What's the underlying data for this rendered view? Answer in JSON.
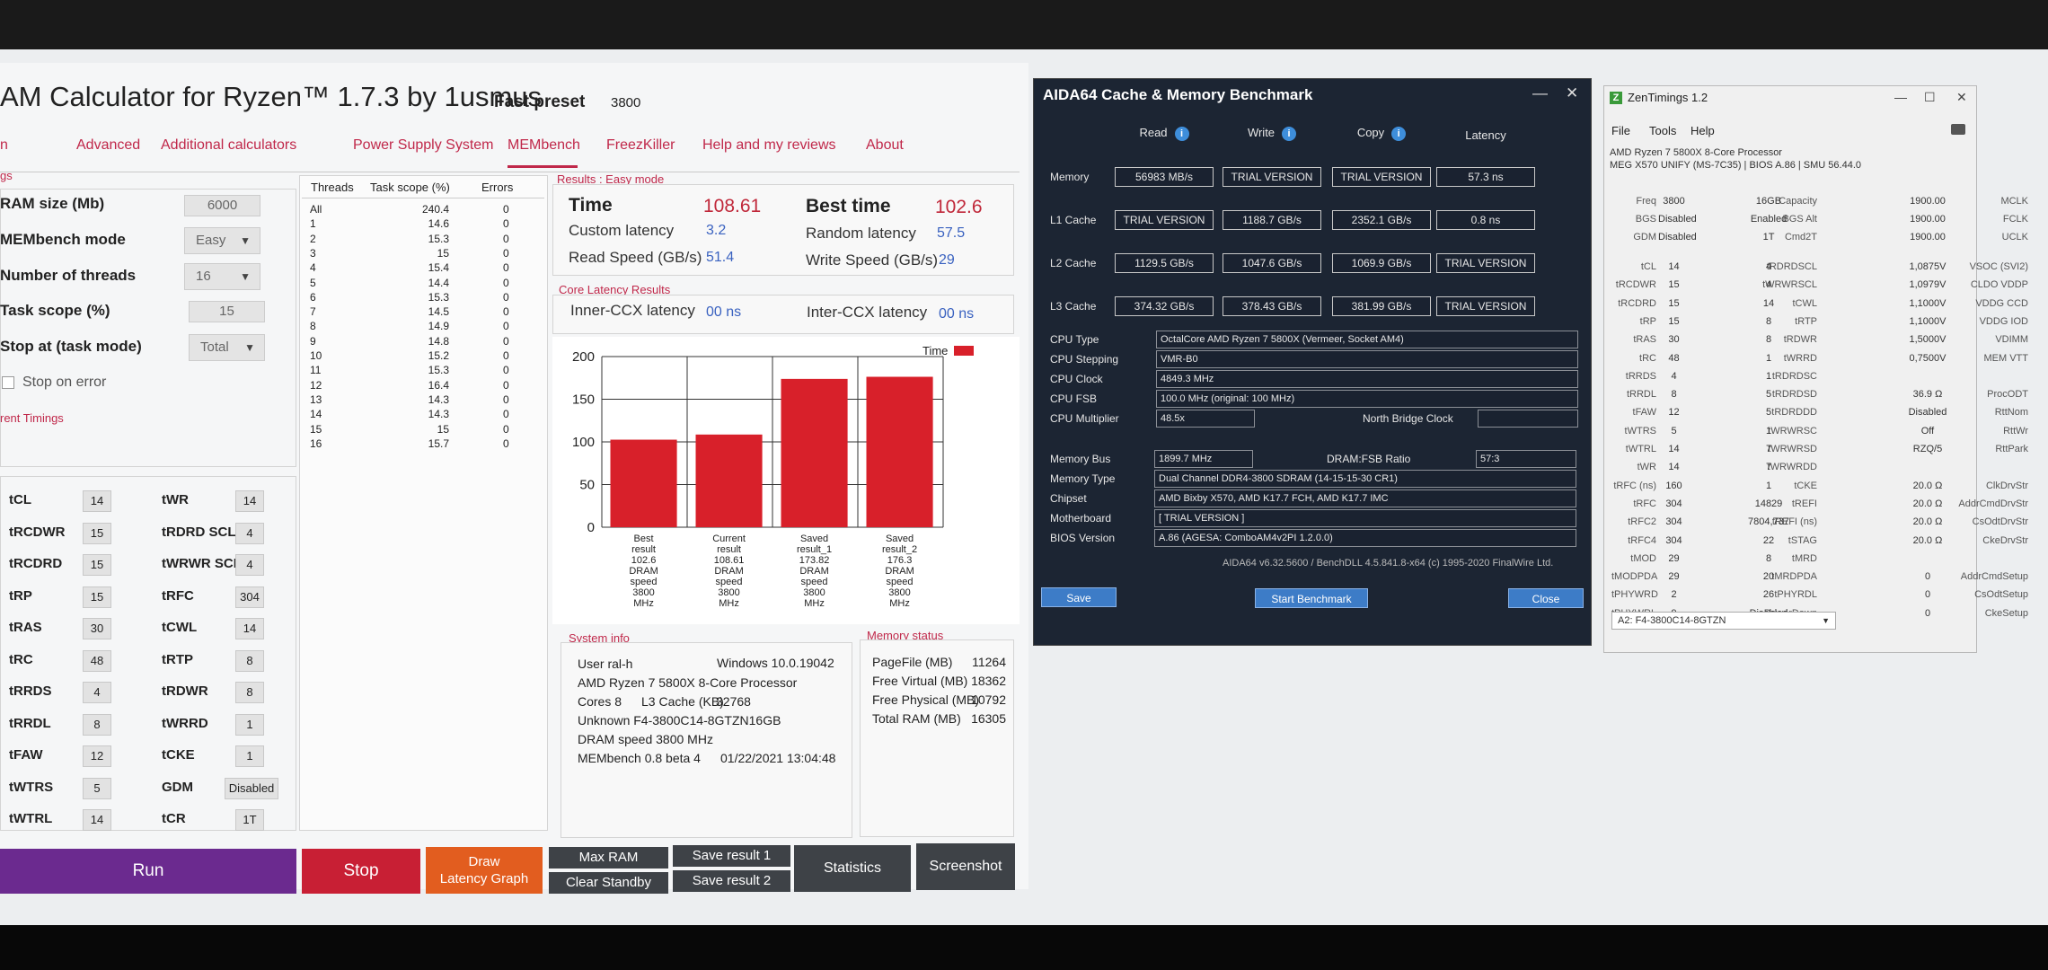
{
  "dram": {
    "title": "AM Calculator for Ryzen™ 1.7.3 by 1usmus",
    "preset_label": "Fast preset",
    "preset_value": "3800",
    "nav": [
      "n",
      "Advanced",
      "Additional calculators",
      "Power Supply System",
      "MEMbench",
      "FreezKiller",
      "Help and my reviews",
      "About"
    ],
    "settings_section": "gs",
    "ram_size_label": "RAM size (Mb)",
    "ram_size_value": "6000",
    "membench_mode_label": "MEMbench mode",
    "membench_mode_value": "Easy",
    "threads_label": "Number of threads",
    "threads_value": "16",
    "task_scope_label": "Task scope (%)",
    "task_scope_value": "15",
    "stop_at_label": "Stop at (task mode)",
    "stop_at_value": "Total",
    "stop_on_error_label": "Stop on error",
    "timings_section": "rent Timings",
    "timings_left": [
      {
        "name": "tCL",
        "value": "14"
      },
      {
        "name": "tRCDWR",
        "value": "15"
      },
      {
        "name": "tRCDRD",
        "value": "15"
      },
      {
        "name": "tRP",
        "value": "15"
      },
      {
        "name": "tRAS",
        "value": "30"
      },
      {
        "name": "tRC",
        "value": "48"
      },
      {
        "name": "tRRDS",
        "value": "4"
      },
      {
        "name": "tRRDL",
        "value": "8"
      },
      {
        "name": "tFAW",
        "value": "12"
      },
      {
        "name": "tWTRS",
        "value": "5"
      },
      {
        "name": "tWTRL",
        "value": "14"
      }
    ],
    "timings_right": [
      {
        "name": "tWR",
        "value": "14"
      },
      {
        "name": "tRDRD SCL",
        "value": "4"
      },
      {
        "name": "tWRWR SCL",
        "value": "4"
      },
      {
        "name": "tRFC",
        "value": "304"
      },
      {
        "name": "tCWL",
        "value": "14"
      },
      {
        "name": "tRTP",
        "value": "8"
      },
      {
        "name": "tRDWR",
        "value": "8"
      },
      {
        "name": "tWRRD",
        "value": "1"
      },
      {
        "name": "tCKE",
        "value": "1"
      },
      {
        "name": "GDM",
        "value": "Disabled"
      },
      {
        "name": "tCR",
        "value": "1T"
      }
    ],
    "thread_table": {
      "headers": [
        "Threads",
        "Task scope (%)",
        "Errors"
      ],
      "rows": [
        [
          "All",
          "240.4",
          "0"
        ],
        [
          "1",
          "14.6",
          "0"
        ],
        [
          "2",
          "15.3",
          "0"
        ],
        [
          "3",
          "15",
          "0"
        ],
        [
          "4",
          "15.4",
          "0"
        ],
        [
          "5",
          "14.4",
          "0"
        ],
        [
          "6",
          "15.3",
          "0"
        ],
        [
          "7",
          "14.5",
          "0"
        ],
        [
          "8",
          "14.9",
          "0"
        ],
        [
          "9",
          "14.8",
          "0"
        ],
        [
          "10",
          "15.2",
          "0"
        ],
        [
          "11",
          "15.3",
          "0"
        ],
        [
          "12",
          "16.4",
          "0"
        ],
        [
          "13",
          "14.3",
          "0"
        ],
        [
          "14",
          "14.3",
          "0"
        ],
        [
          "15",
          "15",
          "0"
        ],
        [
          "16",
          "15.7",
          "0"
        ]
      ]
    },
    "results": {
      "section": "Results : Easy mode",
      "time_label": "Time",
      "time_value": "108.61",
      "best_label": "Best time",
      "best_value": "102.6",
      "custom_latency_label": "Custom latency",
      "custom_latency_value": "3.2",
      "random_latency_label": "Random latency",
      "random_latency_value": "57.5",
      "read_label": "Read Speed (GB/s)",
      "read_value": "51.4",
      "write_label": "Write Speed (GB/s)",
      "write_value": "29"
    },
    "core_latency": {
      "section": "Core Latency Results",
      "inner_label": "Inner-CCX latency",
      "inner_value": "00 ns",
      "inter_label": "Inter-CCX latency",
      "inter_value": "00 ns"
    },
    "system_info": {
      "section": "System info",
      "user": "User ral-h",
      "os": "Windows 10.0.19042",
      "cpu": "AMD Ryzen 7 5800X 8-Core Processor",
      "cores": "Cores 8",
      "l3_label": "L3 Cache (KB)",
      "l3_value": "32768",
      "memory": "Unknown F4-3800C14-8GTZN16GB",
      "dram_speed": "DRAM speed 3800 MHz",
      "membench": "MEMbench 0.8 beta 4",
      "date": "01/22/2021 13:04:48"
    },
    "memory_status": {
      "section": "Memory status",
      "rows": [
        {
          "label": "PageFile (MB)",
          "value": "11264"
        },
        {
          "label": "Free Virtual (MB)",
          "value": "18362"
        },
        {
          "label": "Free Physical (MB)",
          "value": "10792"
        },
        {
          "label": "Total RAM (MB)",
          "value": "16305"
        }
      ]
    },
    "buttons": {
      "run": "Run",
      "stop": "Stop",
      "draw": "Draw\nLatency Graph",
      "max_ram": "Max RAM",
      "clear_standby": "Clear Standby",
      "save1": "Save result 1",
      "save2": "Save result 2",
      "statistics": "Statistics",
      "screenshot": "Screenshot"
    }
  },
  "chart_data": {
    "type": "bar",
    "categories": [
      "Best result 102.6 DRAM speed 3800 MHz",
      "Current result 108.61 DRAM speed 3800 MHz",
      "Saved result_1 173.82 DRAM speed 3800 MHz",
      "Saved result_2 176.3 DRAM speed 3800 MHz"
    ],
    "category_lines": [
      [
        "Best",
        "result",
        "102.6",
        "DRAM",
        "speed",
        "3800",
        "MHz"
      ],
      [
        "Current",
        "result",
        "108.61",
        "DRAM",
        "speed",
        "3800",
        "MHz"
      ],
      [
        "Saved",
        "result_1",
        "173.82",
        "DRAM",
        "speed",
        "3800",
        "MHz"
      ],
      [
        "Saved",
        "result_2",
        "176.3",
        "DRAM",
        "speed",
        "3800",
        "MHz"
      ]
    ],
    "series": [
      {
        "name": "Time",
        "values": [
          102.6,
          108.61,
          173.82,
          176.3
        ],
        "color": "#d8202a"
      }
    ],
    "yticks": [
      "0",
      "50",
      "100",
      "150",
      "200"
    ],
    "ylim": [
      0,
      200
    ],
    "grid": true,
    "legend": "top-right"
  },
  "aida": {
    "title": "AIDA64 Cache & Memory Benchmark",
    "headers": [
      "Read",
      "Write",
      "Copy",
      "Latency"
    ],
    "rows": [
      {
        "label": "Memory",
        "values": [
          "56983 MB/s",
          "TRIAL VERSION",
          "TRIAL VERSION",
          "57.3 ns"
        ]
      },
      {
        "label": "L1 Cache",
        "values": [
          "TRIAL VERSION",
          "1188.7 GB/s",
          "2352.1 GB/s",
          "0.8 ns"
        ]
      },
      {
        "label": "L2 Cache",
        "values": [
          "1129.5 GB/s",
          "1047.6 GB/s",
          "1069.9 GB/s",
          "TRIAL VERSION"
        ]
      },
      {
        "label": "L3 Cache",
        "values": [
          "374.32 GB/s",
          "378.43 GB/s",
          "381.99 GB/s",
          "TRIAL VERSION"
        ]
      }
    ],
    "cpu_type_label": "CPU Type",
    "cpu_type": "OctalCore AMD Ryzen 7 5800X (Vermeer, Socket AM4)",
    "cpu_stepping_label": "CPU Stepping",
    "cpu_stepping": "VMR-B0",
    "cpu_clock_label": "CPU Clock",
    "cpu_clock": "4849.3 MHz",
    "cpu_fsb_label": "CPU FSB",
    "cpu_fsb": "100.0 MHz (original: 100 MHz)",
    "cpu_mult_label": "CPU Multiplier",
    "cpu_mult": "48.5x",
    "nb_clock_label": "North Bridge Clock",
    "mem_bus_label": "Memory Bus",
    "mem_bus": "1899.7 MHz",
    "ratio_label": "DRAM:FSB Ratio",
    "ratio": "57:3",
    "mem_type_label": "Memory Type",
    "mem_type": "Dual Channel DDR4-3800 SDRAM (14-15-15-30 CR1)",
    "chipset_label": "Chipset",
    "chipset": "AMD Bixby X570, AMD K17.7 FCH, AMD K17.7 IMC",
    "motherboard_label": "Motherboard",
    "motherboard": "[ TRIAL VERSION ]",
    "bios_label": "BIOS Version",
    "bios": "A.86 (AGESA: ComboAM4v2PI 1.2.0.0)",
    "footer": "AIDA64 v6.32.5600 / BenchDLL 4.5.841.8-x64 (c) 1995-2020 FinalWire Ltd.",
    "save": "Save",
    "start": "Start Benchmark",
    "close": "Close"
  },
  "zen": {
    "title": "ZenTimings 1.2",
    "menu": [
      "File",
      "Tools",
      "Help"
    ],
    "cpu": "AMD Ryzen 7 5800X 8-Core Processor",
    "board": "MEG X570 UNIFY (MS-7C35) | BIOS A.86 | SMU 56.44.0",
    "top": [
      [
        "Freq",
        "3800",
        "Capacity",
        "16GB",
        "MCLK",
        "1900.00"
      ],
      [
        "BGS",
        "Disabled",
        "BGS Alt",
        "Enabled",
        "FCLK",
        "1900.00"
      ],
      [
        "GDM",
        "Disabled",
        "Cmd2T",
        "1T",
        "UCLK",
        "1900.00"
      ]
    ],
    "timings": [
      [
        "tCL",
        "14",
        "tRDRDSCL",
        "4",
        "VSOC (SVI2)",
        "1,0875V"
      ],
      [
        "tRCDWR",
        "15",
        "tWRWRSCL",
        "4",
        "CLDO VDDP",
        "1,0979V"
      ],
      [
        "tRCDRD",
        "15",
        "tCWL",
        "14",
        "VDDG CCD",
        "1,1000V"
      ],
      [
        "tRP",
        "15",
        "tRTP",
        "8",
        "VDDG IOD",
        "1,1000V"
      ],
      [
        "tRAS",
        "30",
        "tRDWR",
        "8",
        "VDIMM",
        "1,5000V"
      ],
      [
        "tRC",
        "48",
        "tWRRD",
        "1",
        "MEM VTT",
        "0,7500V"
      ],
      [
        "tRRDS",
        "4",
        "tRDRDSC",
        "1",
        "",
        ""
      ],
      [
        "tRRDL",
        "8",
        "tRDRDSD",
        "5",
        "ProcODT",
        "36.9 Ω"
      ],
      [
        "tFAW",
        "12",
        "tRDRDDD",
        "5",
        "RttNom",
        "Disabled"
      ],
      [
        "tWTRS",
        "5",
        "tWRWRSC",
        "1",
        "RttWr",
        "Off"
      ],
      [
        "tWTRL",
        "14",
        "tWRWRSD",
        "7",
        "RttPark",
        "RZQ/5"
      ],
      [
        "tWR",
        "14",
        "tWRWRDD",
        "7",
        "",
        ""
      ],
      [
        "tRFC (ns)",
        "160",
        "tCKE",
        "1",
        "ClkDrvStr",
        "20.0 Ω"
      ],
      [
        "tRFC",
        "304",
        "tREFI",
        "14829",
        "AddrCmdDrvStr",
        "20.0 Ω"
      ],
      [
        "tRFC2",
        "304",
        "tREFI (ns)",
        "7804,737",
        "CsOdtDrvStr",
        "20.0 Ω"
      ],
      [
        "tRFC4",
        "304",
        "tSTAG",
        "22",
        "CkeDrvStr",
        "20.0 Ω"
      ],
      [
        "tMOD",
        "29",
        "tMRD",
        "8",
        "",
        ""
      ],
      [
        "tMODPDA",
        "29",
        "tMRDPDA",
        "20",
        "AddrCmdSetup",
        "0"
      ],
      [
        "tPHYWRD",
        "2",
        "tPHYRDL",
        "26",
        "CsOdtSetup",
        "0"
      ],
      [
        "tPHYWRL",
        "9",
        "PowerDown",
        "Disabled",
        "CkeSetup",
        "0"
      ]
    ],
    "profile": "A2: F4-3800C14-8GTZN"
  }
}
